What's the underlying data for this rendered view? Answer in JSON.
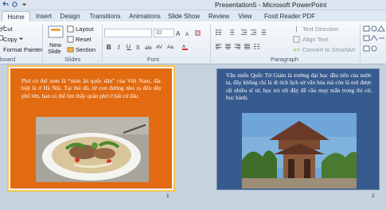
{
  "window": {
    "title": "Presentation5 - Microsoft PowerPoint"
  },
  "tabs": [
    {
      "label": "Home"
    },
    {
      "label": "Insert"
    },
    {
      "label": "Design"
    },
    {
      "label": "Transitions"
    },
    {
      "label": "Animations"
    },
    {
      "label": "Slide Show"
    },
    {
      "label": "Review"
    },
    {
      "label": "View"
    },
    {
      "label": "Foxit Reader PDF"
    }
  ],
  "ribbon": {
    "clipboard": {
      "cut": "Cut",
      "copy": "Copy",
      "format_painter": "Format Painter",
      "group_label": "board"
    },
    "slides": {
      "new_slide": "New",
      "new_slide_line2": "Slide",
      "layout": "Layout",
      "reset": "Reset",
      "section": "Section",
      "group_label": "Slides"
    },
    "font": {
      "size": "32",
      "group_label": "Font"
    },
    "paragraph": {
      "text_direction": "Text Direction",
      "align_text": "Align Text",
      "convert_smartart": "Convert to SmartArt",
      "group_label": "Paragraph"
    }
  },
  "slides": [
    {
      "number": "1",
      "text": "Phở có thể xem là “món ăn quốc dân” của Việt Nam, đặc biệt là ở Hà Nội. Tại thủ đô, từ con đường nhỏ ra đến dãy phố lớn, bạn có thể tìm thấy quán phở ở bất cứ đâu.",
      "background": "#e26a10"
    },
    {
      "number": "2",
      "text": "Văn miếu Quốc Tử Giám là trường đại học đầu tiên của nước ta, đây không chỉ là di tích lịch sử văn hóa mà còn là nơi được rất nhiều sĩ tử, học trò tới đây để cầu may mắn trong thi cử, học hành.",
      "background": "#385b8f"
    }
  ],
  "colors": {
    "accent_selected": "#f2c44f"
  }
}
